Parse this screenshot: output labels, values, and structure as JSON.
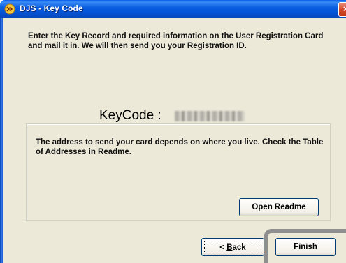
{
  "window": {
    "title": "DJS - Key Code",
    "close_glyph": "×"
  },
  "instructions": "Enter the Key Record and required information on the User Registration Card and mail it in. We will then send you your Registration ID.",
  "keycode": {
    "label": "KeyCode :",
    "value_obscured": true
  },
  "address_note": "The address to send your card depends on where you live. Check the Table of Addresses in Readme.",
  "buttons": {
    "open_readme": "Open Readme",
    "back_prefix": "< ",
    "back_accel": "B",
    "back_rest": "ack",
    "finish": "Finish"
  },
  "colors": {
    "title_bar": "#0453d6",
    "dialog_bg": "#ece9d8",
    "highlight": "#8f8f8f"
  }
}
